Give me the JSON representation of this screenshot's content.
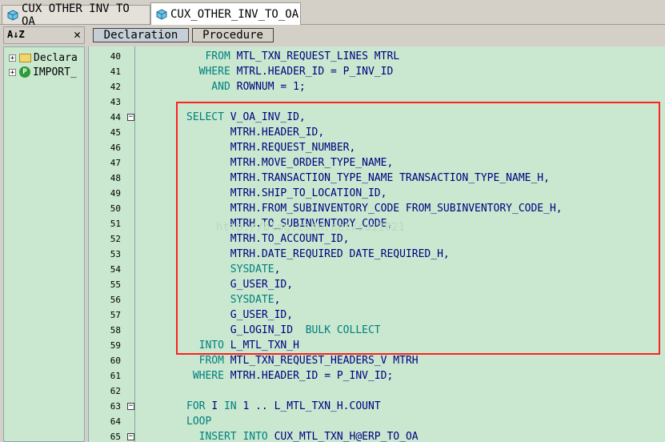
{
  "tabs": [
    {
      "label": "CUX OTHER INV TO OA",
      "active": false
    },
    {
      "label": "CUX_OTHER_INV_TO_OA",
      "active": true
    }
  ],
  "left_toolbar": {
    "sort_glyph": "A↓Z",
    "close_glyph": "✕"
  },
  "tree": [
    {
      "label": "Declara",
      "icon": "folder-icon"
    },
    {
      "label": "IMPORT_",
      "icon": "package-icon"
    }
  ],
  "editor_tabs": [
    {
      "label": "Declaration",
      "selected": true
    },
    {
      "label": "Procedure",
      "selected": false
    }
  ],
  "code_lines": [
    {
      "num": "40",
      "fold": "",
      "tokens": [
        [
          "kw",
          "   FROM "
        ],
        [
          "id",
          "MTL_TXN_REQUEST_LINES MTRL"
        ]
      ]
    },
    {
      "num": "41",
      "fold": "",
      "tokens": [
        [
          "kw",
          "  WHERE "
        ],
        [
          "id",
          "MTRL.HEADER_ID = P_INV_ID"
        ]
      ]
    },
    {
      "num": "42",
      "fold": "",
      "tokens": [
        [
          "kw",
          "    AND "
        ],
        [
          "id",
          "ROWNUM = 1;"
        ]
      ]
    },
    {
      "num": "43",
      "fold": "",
      "tokens": []
    },
    {
      "num": "44",
      "fold": "−",
      "tokens": [
        [
          "kw",
          "SELECT "
        ],
        [
          "id",
          "V_OA_INV_ID,"
        ]
      ]
    },
    {
      "num": "45",
      "fold": "",
      "tokens": [
        [
          "id",
          "       MTRH.HEADER_ID,"
        ]
      ]
    },
    {
      "num": "46",
      "fold": "",
      "tokens": [
        [
          "id",
          "       MTRH.REQUEST_NUMBER,"
        ]
      ]
    },
    {
      "num": "47",
      "fold": "",
      "tokens": [
        [
          "id",
          "       MTRH.MOVE_ORDER_TYPE_NAME,"
        ]
      ]
    },
    {
      "num": "48",
      "fold": "",
      "tokens": [
        [
          "id",
          "       MTRH.TRANSACTION_TYPE_NAME TRANSACTION_TYPE_NAME_H,"
        ]
      ]
    },
    {
      "num": "49",
      "fold": "",
      "tokens": [
        [
          "id",
          "       MTRH.SHIP_TO_LOCATION_ID,"
        ]
      ]
    },
    {
      "num": "50",
      "fold": "",
      "tokens": [
        [
          "id",
          "       MTRH.FROM_SUBINVENTORY_CODE FROM_SUBINVENTORY_CODE_H,"
        ]
      ]
    },
    {
      "num": "51",
      "fold": "",
      "tokens": [
        [
          "id",
          "       MTRH.TO_SUBINVENTORY_CODE,"
        ]
      ]
    },
    {
      "num": "52",
      "fold": "",
      "tokens": [
        [
          "id",
          "       MTRH.TO_ACCOUNT_ID,"
        ]
      ]
    },
    {
      "num": "53",
      "fold": "",
      "tokens": [
        [
          "id",
          "       MTRH.DATE_REQUIRED DATE_REQUIRED_H,"
        ]
      ]
    },
    {
      "num": "54",
      "fold": "",
      "tokens": [
        [
          "kw",
          "       SYSDATE"
        ],
        [
          "id",
          ","
        ]
      ]
    },
    {
      "num": "55",
      "fold": "",
      "tokens": [
        [
          "id",
          "       G_USER_ID,"
        ]
      ]
    },
    {
      "num": "56",
      "fold": "",
      "tokens": [
        [
          "kw",
          "       SYSDATE"
        ],
        [
          "id",
          ","
        ]
      ]
    },
    {
      "num": "57",
      "fold": "",
      "tokens": [
        [
          "id",
          "       G_USER_ID,"
        ]
      ]
    },
    {
      "num": "58",
      "fold": "",
      "tokens": [
        [
          "id",
          "       G_LOGIN_ID  "
        ],
        [
          "kw",
          "BULK COLLECT"
        ]
      ]
    },
    {
      "num": "59",
      "fold": "",
      "tokens": [
        [
          "kw",
          "  INTO "
        ],
        [
          "id",
          "L_MTL_TXN_H"
        ]
      ]
    },
    {
      "num": "60",
      "fold": "",
      "tokens": [
        [
          "kw",
          "  FROM "
        ],
        [
          "id",
          "MTL_TXN_REQUEST_HEADERS_V MTRH"
        ]
      ]
    },
    {
      "num": "61",
      "fold": "",
      "tokens": [
        [
          "kw",
          " WHERE "
        ],
        [
          "id",
          "MTRH.HEADER_ID = P_INV_ID;"
        ]
      ]
    },
    {
      "num": "62",
      "fold": "",
      "tokens": []
    },
    {
      "num": "63",
      "fold": "−",
      "tokens": [
        [
          "kw",
          "FOR "
        ],
        [
          "id",
          "I "
        ],
        [
          "kw",
          "IN "
        ],
        [
          "id",
          "1 .. L_MTL_TXN_H.COUNT"
        ]
      ]
    },
    {
      "num": "64",
      "fold": "",
      "tokens": [
        [
          "kw",
          "LOOP"
        ]
      ]
    },
    {
      "num": "65",
      "fold": "−",
      "tokens": [
        [
          "kw",
          "  INSERT INTO "
        ],
        [
          "id",
          "CUX_MTL_TXN_H@ERP_TO_OA"
        ]
      ]
    }
  ],
  "watermark": "http://blog.csdn.net/sai1021",
  "colors": {
    "keyword": "#008080",
    "identifier": "#000080",
    "editor_bg": "#c9e8cf",
    "highlight_box": "#ff2020"
  }
}
